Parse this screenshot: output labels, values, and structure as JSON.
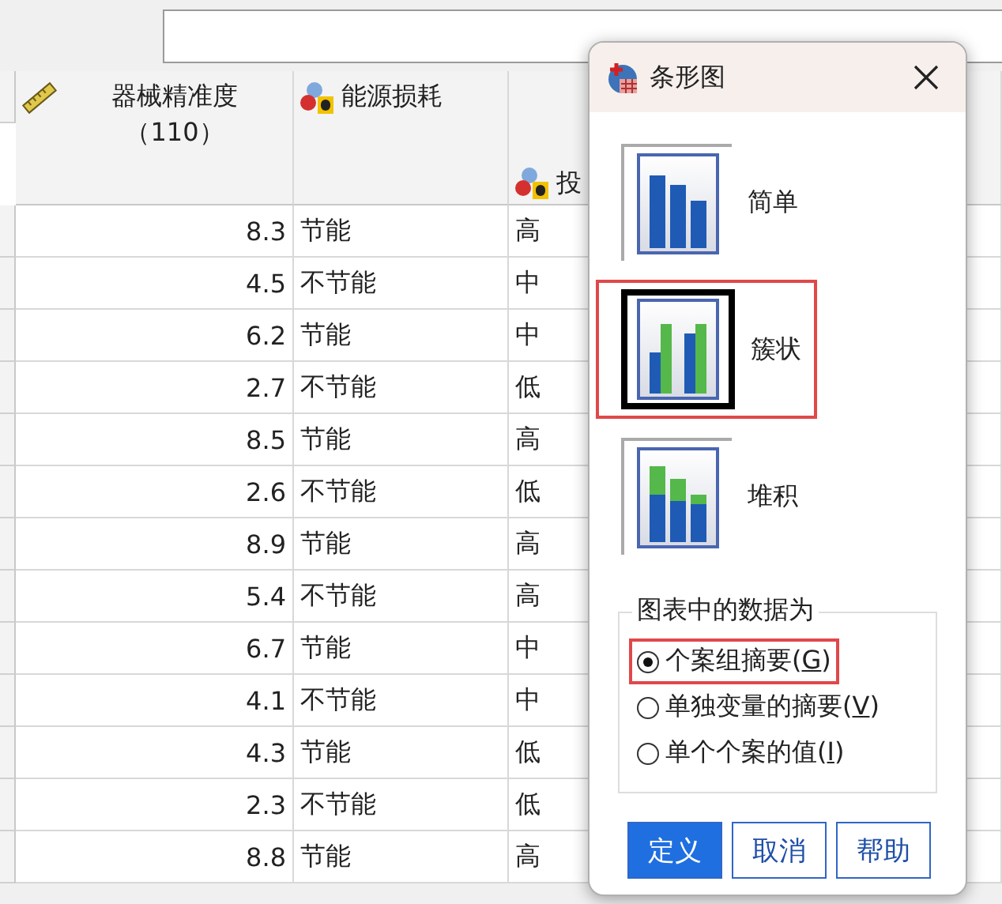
{
  "table": {
    "columns": [
      {
        "kind": "scale",
        "label": "器械精准度（110）"
      },
      {
        "kind": "nominal",
        "label": "能源损耗"
      },
      {
        "kind": "nominal",
        "label": "投"
      }
    ],
    "rows": [
      [
        "8.3",
        "节能",
        "高"
      ],
      [
        "4.5",
        "不节能",
        "中"
      ],
      [
        "6.2",
        "节能",
        "中"
      ],
      [
        "2.7",
        "不节能",
        "低"
      ],
      [
        "8.5",
        "节能",
        "高"
      ],
      [
        "2.6",
        "不节能",
        "低"
      ],
      [
        "8.9",
        "节能",
        "高"
      ],
      [
        "5.4",
        "不节能",
        "高"
      ],
      [
        "6.7",
        "节能",
        "中"
      ],
      [
        "4.1",
        "不节能",
        "中"
      ],
      [
        "4.3",
        "节能",
        "低"
      ],
      [
        "2.3",
        "不节能",
        "低"
      ],
      [
        "8.8",
        "节能",
        "高"
      ]
    ]
  },
  "dialog": {
    "title": "条形图",
    "chart_types": [
      {
        "kind": "simple",
        "label": "简单",
        "selected": false,
        "highlighted": false
      },
      {
        "kind": "clustered",
        "label": "簇状",
        "selected": true,
        "highlighted": true
      },
      {
        "kind": "stacked",
        "label": "堆积",
        "selected": false,
        "highlighted": false
      }
    ],
    "data_group": {
      "title": "图表中的数据为",
      "options": [
        {
          "label": "个案组摘要(",
          "mnemonic": "G",
          "after": ")",
          "selected": true,
          "highlighted": true
        },
        {
          "label": "单独变量的摘要(",
          "mnemonic": "V",
          "after": ")",
          "selected": false,
          "highlighted": false
        },
        {
          "label": "单个个案的值(",
          "mnemonic": "I",
          "after": ")",
          "selected": false,
          "highlighted": false
        }
      ]
    },
    "buttons": [
      {
        "label": "定义",
        "default": true
      },
      {
        "label": "取消",
        "default": false
      },
      {
        "label": "帮助",
        "default": false
      }
    ]
  }
}
